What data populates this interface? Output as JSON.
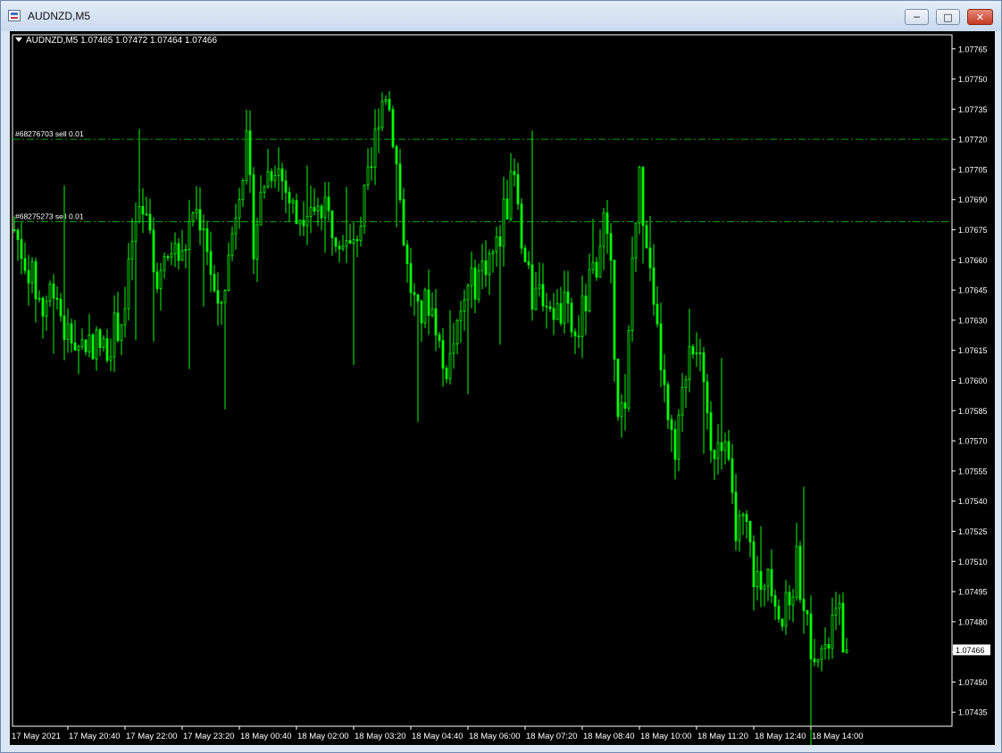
{
  "window": {
    "title": "AUDNZD,M5",
    "minimize_icon": "minimize-icon",
    "maximize_icon": "maximize-icon",
    "close_icon": "close-icon"
  },
  "chart_header": "AUDNZD,M5  1.07465 1.07472 1.07464 1.07466",
  "colors": {
    "background": "#000000",
    "candles": "#00ff00",
    "axis": "#ffffff",
    "order_line": "#00a000",
    "bid_label_bg": "#ffffff"
  },
  "chart_data": {
    "type": "candlestick",
    "symbol": "AUDNZD",
    "timeframe": "M5",
    "ohlc_last": {
      "open": 1.07465,
      "high": 1.07472,
      "low": 1.07464,
      "close": 1.07466
    },
    "current_price": "1.07466",
    "ylim": [
      1.07428,
      1.07772
    ],
    "y_ticks": [
      "1.07765",
      "1.07750",
      "1.07735",
      "1.07720",
      "1.07705",
      "1.07690",
      "1.07675",
      "1.07660",
      "1.07645",
      "1.07630",
      "1.07615",
      "1.07600",
      "1.07585",
      "1.07570",
      "1.07555",
      "1.07540",
      "1.07525",
      "1.07510",
      "1.07495",
      "1.07480",
      "1.07465",
      "1.07450",
      "1.07435"
    ],
    "x_ticks": [
      "17 May 2021",
      "17 May 20:40",
      "17 May 22:00",
      "17 May 23:20",
      "18 May 00:40",
      "18 May 02:00",
      "18 May 03:20",
      "18 May 04:40",
      "18 May 06:00",
      "18 May 07:20",
      "18 May 08:40",
      "18 May 10:00",
      "18 May 11:20",
      "18 May 12:40",
      "18 May 14:00"
    ],
    "orders": [
      {
        "label": "#68276703 sell 0.01",
        "price": 1.0772
      },
      {
        "label": "#68275273 sell 0.01",
        "price": 1.07679
      }
    ],
    "price_path": [
      [
        0,
        1.07675
      ],
      [
        4,
        1.07655
      ],
      [
        8,
        1.07635
      ],
      [
        11,
        1.0765
      ],
      [
        14,
        1.07625
      ],
      [
        18,
        1.07618
      ],
      [
        22,
        1.0762
      ],
      [
        25,
        1.07615
      ],
      [
        28,
        1.07625
      ],
      [
        31,
        1.07635
      ],
      [
        33,
        1.0767
      ],
      [
        36,
        1.07685
      ],
      [
        38,
        1.07665
      ],
      [
        41,
        1.0765
      ],
      [
        44,
        1.07665
      ],
      [
        47,
        1.0766
      ],
      [
        50,
        1.07685
      ],
      [
        53,
        1.0768
      ],
      [
        55,
        1.07655
      ],
      [
        57,
        1.0763
      ],
      [
        60,
        1.0766
      ],
      [
        63,
        1.077
      ],
      [
        65,
        1.07715
      ],
      [
        67,
        1.0767
      ],
      [
        70,
        1.077
      ],
      [
        73,
        1.0771
      ],
      [
        76,
        1.07695
      ],
      [
        79,
        1.0768
      ],
      [
        82,
        1.0769
      ],
      [
        85,
        1.07685
      ],
      [
        88,
        1.0768
      ],
      [
        91,
        1.07675
      ],
      [
        94,
        1.07665
      ],
      [
        97,
        1.0768
      ],
      [
        100,
        1.07705
      ],
      [
        102,
        1.07735
      ],
      [
        104,
        1.07745
      ],
      [
        106,
        1.07725
      ],
      [
        108,
        1.0769
      ],
      [
        110,
        1.07655
      ],
      [
        113,
        1.0763
      ],
      [
        116,
        1.0764
      ],
      [
        118,
        1.0763
      ],
      [
        120,
        1.07605
      ],
      [
        123,
        1.07615
      ],
      [
        126,
        1.0764
      ],
      [
        129,
        1.0765
      ],
      [
        132,
        1.0766
      ],
      [
        135,
        1.07665
      ],
      [
        138,
        1.0769
      ],
      [
        140,
        1.077
      ],
      [
        142,
        1.07665
      ],
      [
        145,
        1.0764
      ],
      [
        148,
        1.07645
      ],
      [
        151,
        1.0763
      ],
      [
        154,
        1.07635
      ],
      [
        157,
        1.0762
      ],
      [
        160,
        1.0764
      ],
      [
        163,
        1.0766
      ],
      [
        165,
        1.0768
      ],
      [
        167,
        1.0765
      ],
      [
        169,
        1.0759
      ],
      [
        171,
        1.0758
      ],
      [
        173,
        1.0766
      ],
      [
        175,
        1.077
      ],
      [
        177,
        1.0767
      ],
      [
        179,
        1.0763
      ],
      [
        181,
        1.0761
      ],
      [
        183,
        1.07575
      ],
      [
        185,
        1.0756
      ],
      [
        187,
        1.0759
      ],
      [
        189,
        1.0762
      ],
      [
        191,
        1.0762
      ],
      [
        193,
        1.0759
      ],
      [
        195,
        1.0756
      ],
      [
        197,
        1.07575
      ],
      [
        199,
        1.0757
      ],
      [
        201,
        1.07535
      ],
      [
        203,
        1.07525
      ],
      [
        205,
        1.07525
      ],
      [
        207,
        1.07505
      ],
      [
        209,
        1.07495
      ],
      [
        211,
        1.0751
      ],
      [
        213,
        1.07495
      ],
      [
        215,
        1.0748
      ],
      [
        217,
        1.0749
      ],
      [
        219,
        1.0751
      ],
      [
        221,
        1.0749
      ],
      [
        223,
        1.0747
      ],
      [
        225,
        1.0747
      ],
      [
        227,
        1.0746
      ],
      [
        229,
        1.0748
      ],
      [
        231,
        1.0748
      ],
      [
        233,
        1.07465
      ]
    ]
  }
}
